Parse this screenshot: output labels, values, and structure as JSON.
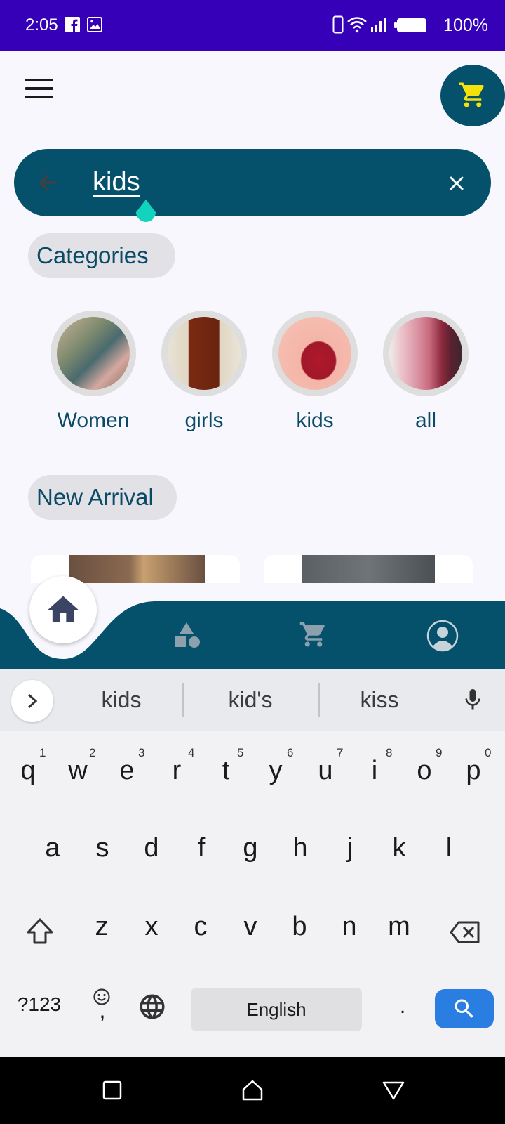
{
  "status_bar": {
    "time": "2:05",
    "battery": "100%"
  },
  "search": {
    "query": "kids"
  },
  "categories": {
    "title": "Categories",
    "items": [
      {
        "label": "Women"
      },
      {
        "label": "girls"
      },
      {
        "label": "kids"
      },
      {
        "label": "all"
      }
    ]
  },
  "new_arrival": {
    "title": "New Arrival"
  },
  "keyboard": {
    "suggestions": [
      "kids",
      "kid's",
      "kiss"
    ],
    "row1": [
      "q",
      "w",
      "e",
      "r",
      "t",
      "y",
      "u",
      "i",
      "o",
      "p"
    ],
    "row1_nums": [
      "1",
      "2",
      "3",
      "4",
      "5",
      "6",
      "7",
      "8",
      "9",
      "0"
    ],
    "row2": [
      "a",
      "s",
      "d",
      "f",
      "g",
      "h",
      "j",
      "k",
      "l"
    ],
    "row3": [
      "z",
      "x",
      "c",
      "v",
      "b",
      "n",
      "m"
    ],
    "symbols_label": "?123",
    "comma_label": ",",
    "space_label": "English",
    "period_label": "."
  },
  "colors": {
    "status_bar": "#3500b8",
    "primary": "#05506a",
    "cart_icon": "#f5e10a",
    "cursor_handle": "#12d3bd",
    "search_key": "#2a7de1"
  }
}
